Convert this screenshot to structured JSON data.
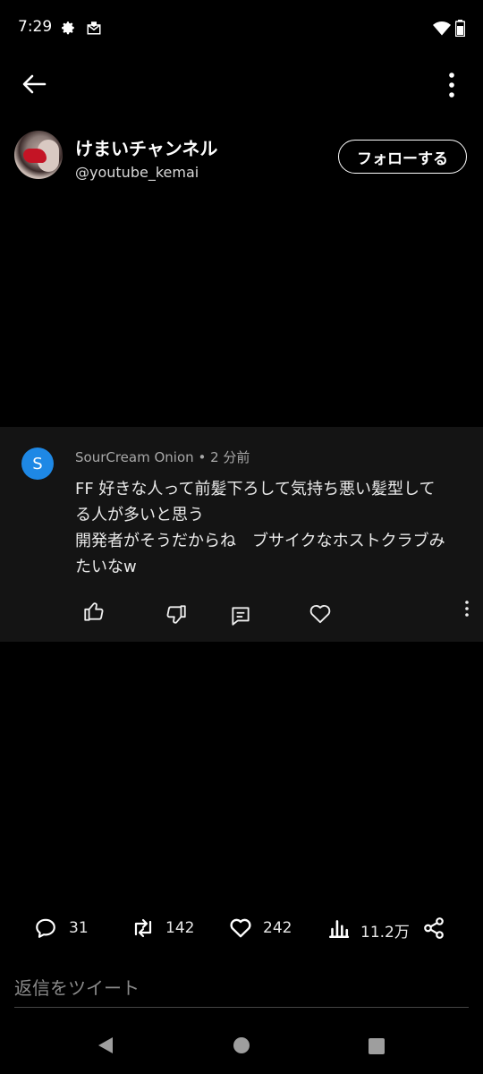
{
  "status_bar": {
    "time": "7:29"
  },
  "profile": {
    "name": "けまいチャンネル",
    "handle": "@youtube_kemai",
    "follow_label": "フォローする"
  },
  "comment": {
    "avatar_letter": "S",
    "author": "SourCream Onion",
    "separator": "•",
    "time": "2 分前",
    "text": "FF 好きな人って前髪下ろして気持ち悪い髪型して\nる人が多いと思う\n開発者がそうだからね　ブサイクなホストクラブみ\nたいなw"
  },
  "stats": {
    "replies": "31",
    "retweets": "142",
    "likes": "242",
    "views": "11.2万"
  },
  "reply_placeholder": "返信をツイート",
  "colors": {
    "accent": "#1e88e5",
    "background": "#000000",
    "card": "#141414"
  }
}
